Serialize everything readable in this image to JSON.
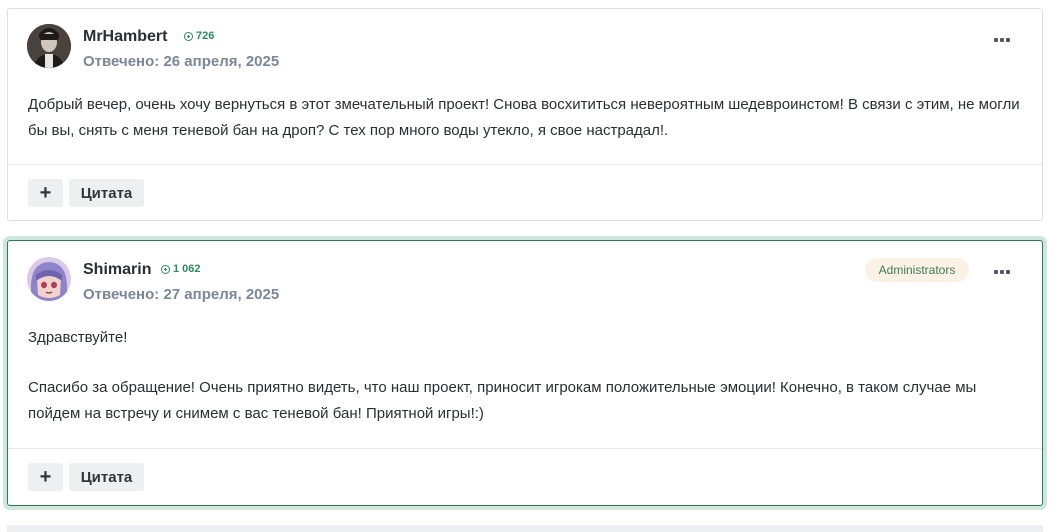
{
  "posts": [
    {
      "author": "MrHambert",
      "reputation": "726",
      "date": "Отвечено: 26 апреля, 2025",
      "paragraphs": [
        "Добрый вечер, очень хочу вернуться в этот змечательный проект! Снова восхититься невероятным шедевроинстом! В связи с этим, не могли бы вы, снять с меня теневой бан на дроп? С тех пор много воды утекло, я свое настрадал!."
      ],
      "plus_label": "+",
      "quote_label": "Цитата",
      "more_icon": "ellipsis-icon"
    },
    {
      "author": "Shimarin",
      "reputation": "1 062",
      "date": "Отвечено: 27 апреля, 2025",
      "badge": "Administrators",
      "paragraphs": [
        "Здравствуйте!",
        "Спасибо за обращение! Очень приятно видеть, что наш проект, приносит игрокам положительные эмоции! Конечно, в таком случае мы пойдем на встречу и снимем с вас теневой бан! Приятной игры!:)"
      ],
      "plus_label": "+",
      "quote_label": "Цитата",
      "more_icon": "ellipsis-icon"
    }
  ],
  "colors": {
    "accent_green": "#2f8a5f",
    "highlight_border": "#2f7a5a",
    "badge_bg": "#fbf1e4",
    "date_gray": "#7b8797"
  }
}
